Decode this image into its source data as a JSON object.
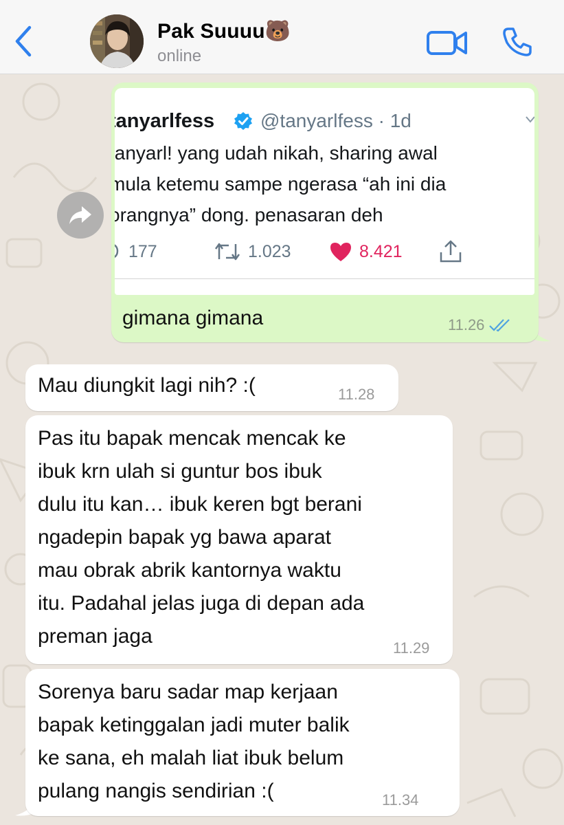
{
  "header": {
    "back_icon": "chevron-left-icon",
    "contact_name": "Pak Suuuu🐻",
    "status": "online",
    "video_icon": "video-camera-icon",
    "call_icon": "phone-icon",
    "accent_color": "#2f80ed"
  },
  "messages": {
    "outgoing": {
      "tweet": {
        "name": "tanyarlfess",
        "handle": "@tanyarlfess · 1d",
        "text_lines": [
          "tanyarl! yang udah nikah, sharing awal",
          "mula ketemu sampe ngerasa “ah ini dia",
          "orangnya” dong. penasaran deh"
        ],
        "reply_count": "177",
        "retweet_count": "1.023",
        "like_count": "8.421"
      },
      "text": "gimana gimana",
      "time": "11.26",
      "status_icon": "double-check-icon"
    },
    "incoming": [
      {
        "lines": [
          "Mau diungkit lagi nih? :("
        ],
        "time": "11.28"
      },
      {
        "lines": [
          "Pas itu bapak mencak mencak ke",
          "ibuk krn ulah si guntur bos ibuk",
          "dulu itu kan… ibuk keren bgt berani",
          "ngadepin bapak yg bawa aparat",
          "mau obrak abrik kantornya waktu",
          "itu. Padahal jelas juga di depan ada",
          "preman jaga"
        ],
        "time": "11.29"
      },
      {
        "lines": [
          "Sorenya baru sadar map kerjaan",
          "bapak ketinggalan jadi muter balik",
          "ke sana, eh malah liat ibuk belum",
          "pulang nangis sendirian :("
        ],
        "time": "11.34"
      }
    ]
  },
  "colors": {
    "outgoing_bubble": "#dcf8c6",
    "incoming_bubble": "#ffffff",
    "like": "#e0245e",
    "verified": "#1da1f2",
    "read_ticks": "#4fa3e0"
  }
}
